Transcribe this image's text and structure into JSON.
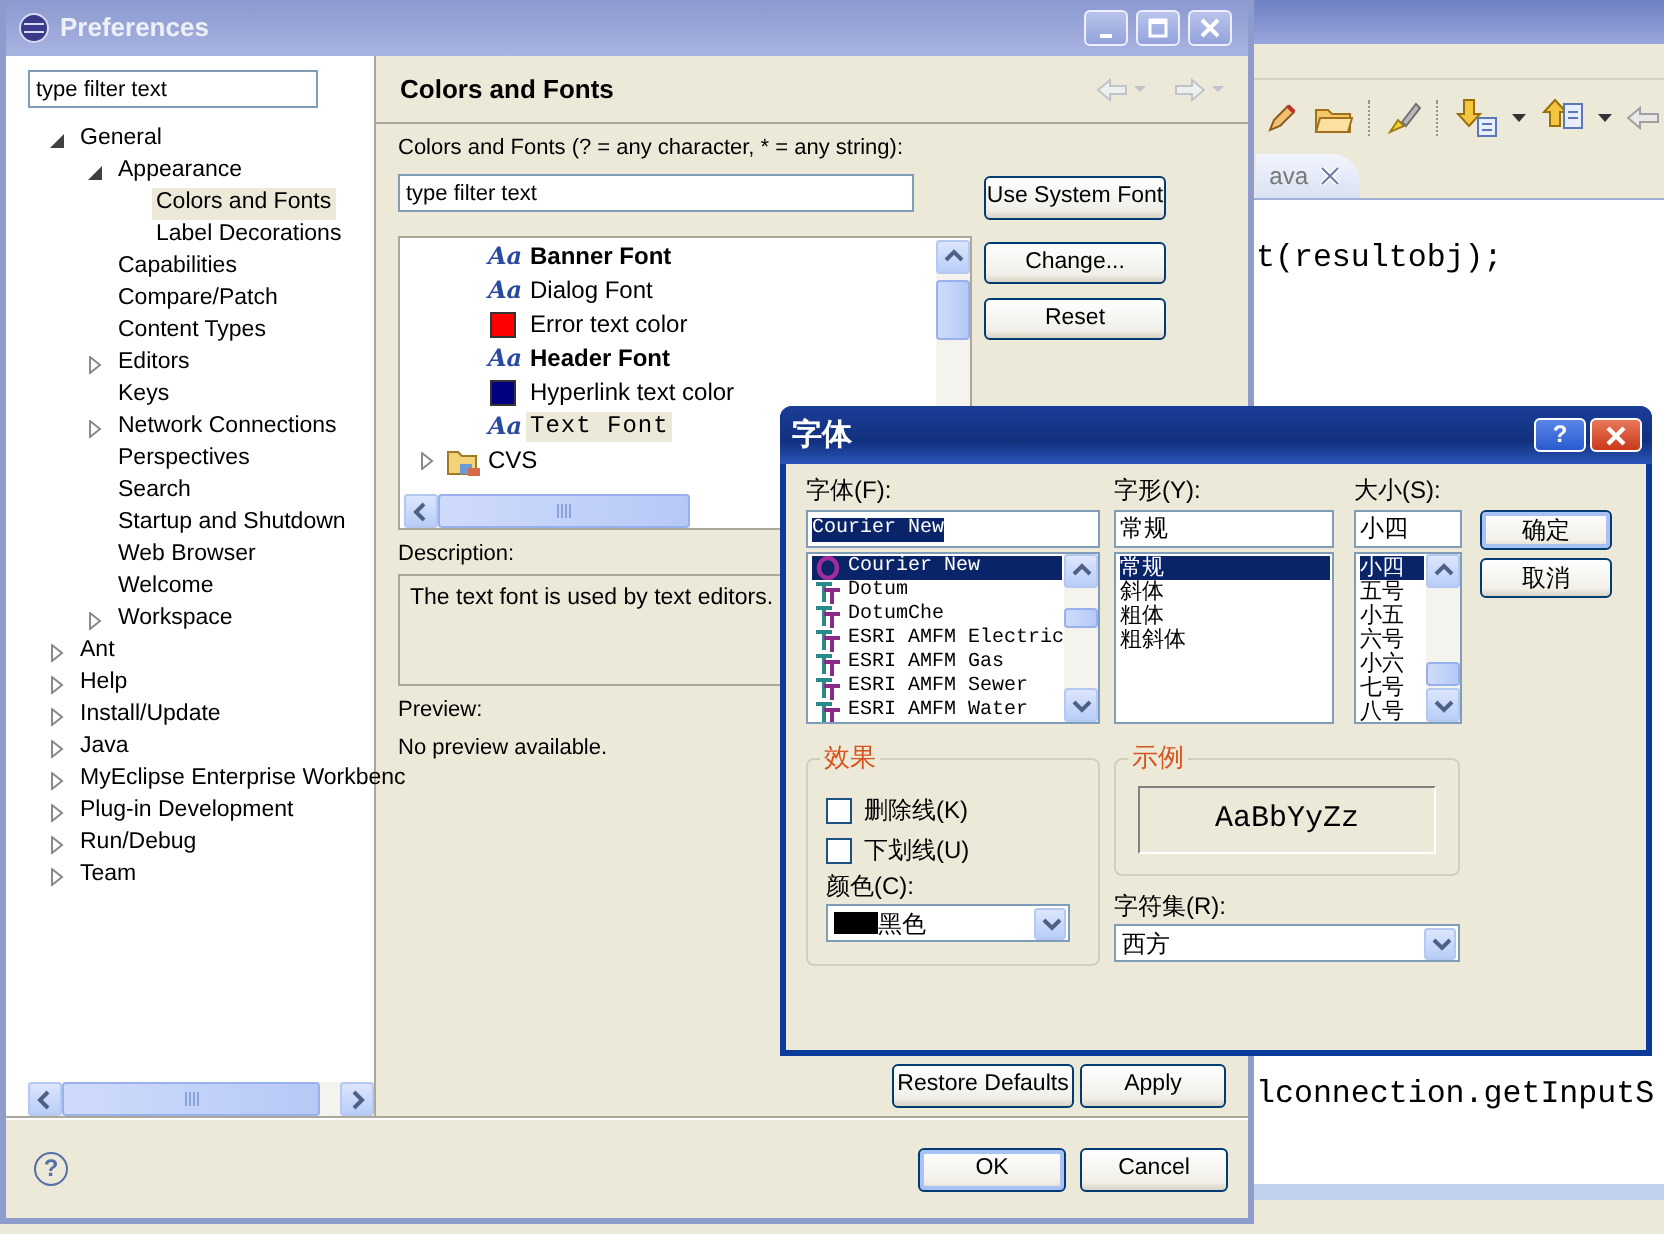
{
  "ide": {
    "editor_tab": "ava",
    "code_lines": [
      "t(resultobj);",
      "lconnection.getInputS"
    ]
  },
  "preferences": {
    "title": "Preferences",
    "filter_value": "type filter text",
    "tree": [
      {
        "label": "General",
        "expanded": true,
        "selected": false,
        "children": [
          {
            "label": "Appearance",
            "expanded": true,
            "selected": false,
            "children": [
              {
                "label": "Colors and Fonts",
                "selected": true
              },
              {
                "label": "Label Decorations",
                "selected": false
              }
            ]
          },
          {
            "label": "Capabilities",
            "selected": false
          },
          {
            "label": "Compare/Patch",
            "selected": false
          },
          {
            "label": "Content Types",
            "selected": false
          },
          {
            "label": "Editors",
            "expanded": false,
            "selected": false
          },
          {
            "label": "Keys",
            "selected": false
          },
          {
            "label": "Network Connections",
            "expanded": false,
            "selected": false
          },
          {
            "label": "Perspectives",
            "selected": false
          },
          {
            "label": "Search",
            "selected": false
          },
          {
            "label": "Startup and Shutdown",
            "selected": false
          },
          {
            "label": "Web Browser",
            "selected": false
          },
          {
            "label": "Welcome",
            "selected": false
          },
          {
            "label": "Workspace",
            "expanded": false,
            "selected": false
          }
        ]
      },
      {
        "label": "Ant",
        "expanded": false,
        "selected": false
      },
      {
        "label": "Help",
        "expanded": false,
        "selected": false
      },
      {
        "label": "Install/Update",
        "expanded": false,
        "selected": false
      },
      {
        "label": "Java",
        "expanded": false,
        "selected": false
      },
      {
        "label": "MyEclipse Enterprise Workbenc",
        "expanded": false,
        "selected": false
      },
      {
        "label": "Plug-in Development",
        "expanded": false,
        "selected": false
      },
      {
        "label": "Run/Debug",
        "expanded": false,
        "selected": false
      },
      {
        "label": "Team",
        "expanded": false,
        "selected": false
      }
    ],
    "page": {
      "title": "Colors and Fonts",
      "filter_label": "Colors and Fonts (? = any character, * = any string):",
      "filter_value": "type filter text",
      "color_tree": [
        {
          "kind": "boldfont",
          "icon": "Aa",
          "label": "Banner Font",
          "selected": false
        },
        {
          "kind": "font",
          "icon": "Aa",
          "label": "Dialog Font",
          "selected": false
        },
        {
          "kind": "color",
          "color": "#ff0000",
          "label": "Error text color",
          "selected": false
        },
        {
          "kind": "boldfont",
          "icon": "Aa",
          "label": "Header Font",
          "selected": false
        },
        {
          "kind": "color",
          "color": "#000080",
          "label": "Hyperlink text color",
          "selected": false
        },
        {
          "kind": "monofont",
          "icon": "Aa",
          "label": "Text Font",
          "selected": true
        },
        {
          "kind": "category",
          "label": "CVS",
          "expanded": false,
          "selected": false
        }
      ],
      "buttons": [
        "Use System Font",
        "Change...",
        "Reset"
      ],
      "description_label": "Description:",
      "description": "The text font is used by text editors.",
      "preview_label": "Preview:",
      "preview": "No preview available."
    },
    "restore_defaults": "Restore Defaults",
    "apply": "Apply",
    "help": "?",
    "dialog_buttons": [
      {
        "label": "OK",
        "default": true
      },
      {
        "label": "Cancel",
        "default": false
      }
    ]
  },
  "font_dialog": {
    "title": "字体",
    "help_button": "?",
    "font": {
      "label": "字体(F):",
      "value": "Courier New",
      "value_highlighted": true,
      "items": [
        {
          "kind": "opentype",
          "label": "Courier New",
          "selected": true
        },
        {
          "kind": "truetype",
          "label": "Dotum",
          "selected": false
        },
        {
          "kind": "truetype",
          "label": "DotumChe",
          "selected": false
        },
        {
          "kind": "truetype",
          "label": "ESRI AMFM Electric",
          "selected": false
        },
        {
          "kind": "truetype",
          "label": "ESRI AMFM Gas",
          "selected": false
        },
        {
          "kind": "truetype",
          "label": "ESRI AMFM Sewer",
          "selected": false
        },
        {
          "kind": "truetype",
          "label": "ESRI AMFM Water",
          "selected": false
        }
      ]
    },
    "style": {
      "label": "字形(Y):",
      "value": "常规",
      "items": [
        {
          "label": "常规",
          "selected": true
        },
        {
          "label": "斜体",
          "selected": false
        },
        {
          "label": "粗体",
          "selected": false
        },
        {
          "label": "粗斜体",
          "selected": false
        }
      ]
    },
    "size": {
      "label": "大小(S):",
      "value": "小四",
      "items": [
        {
          "label": "小四",
          "selected": true
        },
        {
          "label": "五号",
          "selected": false
        },
        {
          "label": "小五",
          "selected": false
        },
        {
          "label": "六号",
          "selected": false
        },
        {
          "label": "小六",
          "selected": false
        },
        {
          "label": "七号",
          "selected": false
        },
        {
          "label": "八号",
          "selected": false
        }
      ]
    },
    "buttons": [
      {
        "label": "确定",
        "default": true
      },
      {
        "label": "取消",
        "default": false
      }
    ],
    "effects": {
      "title": "效果",
      "options": [
        {
          "label": "删除线(K)",
          "checked": false
        },
        {
          "label": "下划线(U)",
          "checked": false
        }
      ],
      "color_label": "颜色(C):",
      "color": {
        "label": "黑色",
        "color": "#000000"
      }
    },
    "sample": {
      "title": "示例",
      "text": "AaBbYyZz"
    },
    "charset": {
      "label": "字符集(R):",
      "value": "西方"
    }
  }
}
